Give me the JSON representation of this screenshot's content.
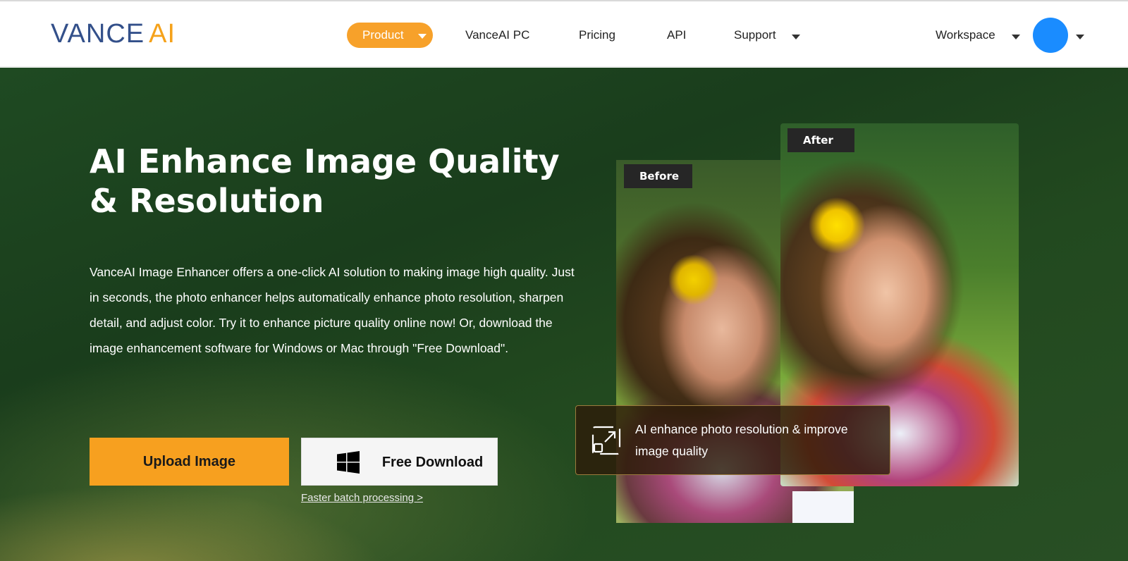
{
  "header": {
    "logo": {
      "part1": "VANCE",
      "part2": "AI"
    },
    "nav": {
      "product": "Product",
      "pc": "VanceAI PC",
      "pricing": "Pricing",
      "api": "API",
      "support": "Support",
      "workspace": "Workspace"
    },
    "avatar_color": "#1a8cff"
  },
  "hero": {
    "title": "AI Enhance Image Quality & Resolution",
    "description": "VanceAI Image Enhancer offers a one-click AI solution to making image high quality. Just in seconds, the photo enhancer helps automatically enhance photo resolution, sharpen detail, and adjust color. Try it to enhance picture quality online now! Or, download the image enhancement software for Windows or Mac through \"Free Download\".",
    "upload_button": "Upload Image",
    "download_button": "Free Download",
    "batch_link": "Faster batch processing >",
    "before_label": "Before",
    "after_label": "After",
    "feature_text": "AI enhance photo resolution & improve image quality"
  },
  "colors": {
    "accent": "#f7a01f",
    "logo_blue": "#33508a",
    "hero_green": "#1f4a22"
  }
}
